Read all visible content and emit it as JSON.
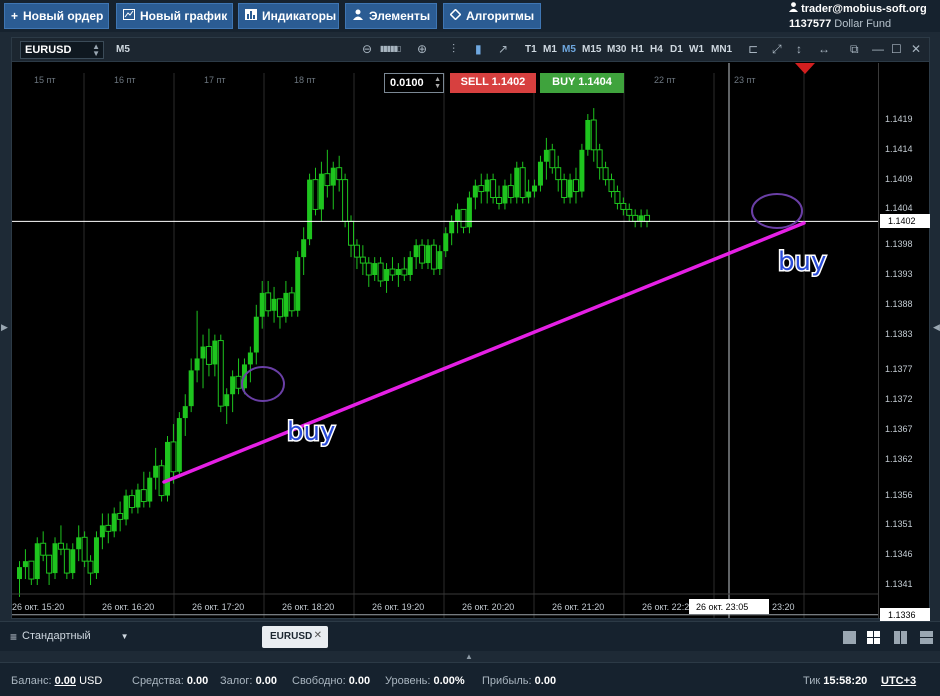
{
  "toolbar": {
    "new_order": "Новый ордер",
    "new_chart": "Новый график",
    "indicators": "Индикаторы",
    "elements": "Элементы",
    "algorithms": "Алгоритмы"
  },
  "account": {
    "email": "trader@mobius-soft.org",
    "account_id": "1137577",
    "fund_name": "Dollar Fund"
  },
  "chart": {
    "symbol": "EURUSD",
    "timeframe": "M5",
    "timeframes": [
      "T1",
      "M1",
      "M5",
      "M15",
      "M30",
      "H1",
      "H4",
      "D1",
      "W1",
      "MN1"
    ],
    "active_timeframe": "M5",
    "lot": "0.0100",
    "sell_label": "SELL",
    "sell_price": "1.1402",
    "buy_label": "BUY",
    "buy_price": "1.1404",
    "top_day_labels": [
      "15 пт",
      "16 пт",
      "17 пт",
      "18 пт",
      "22 пт",
      "23 пт"
    ],
    "price_labels": [
      "1.1419",
      "1.1414",
      "1.1409",
      "1.1404",
      "1.1398",
      "1.1393",
      "1.1388",
      "1.1383",
      "1.1377",
      "1.1372",
      "1.1367",
      "1.1362",
      "1.1356",
      "1.1351",
      "1.1346",
      "1.1341"
    ],
    "current_price": "1.1402",
    "low_price_marker": "1.1336",
    "time_labels": [
      "26 окт. 15:20",
      "26 окт. 16:20",
      "26 окт. 17:20",
      "26 окт. 18:20",
      "26 окт. 19:20",
      "26 окт. 20:20",
      "26 окт. 21:20",
      "26 окт. 22:20",
      "23:20"
    ],
    "crosshair_time": "26 окт. 23:05",
    "annotation_1": "buy",
    "annotation_2": "buy",
    "colors": {
      "bull": "#1ec41e",
      "trend_line": "#e520e5",
      "circle": "#6a3fa6",
      "annotation": "#2a4bd8",
      "sell": "#d7403f",
      "buy": "#3fa33d"
    },
    "chart_data": {
      "type": "candlestick",
      "ylim": [
        1.1336,
        1.1422
      ],
      "candles": [
        [
          1.1342,
          1.1345,
          1.1339,
          1.1344
        ],
        [
          1.1344,
          1.1347,
          1.1342,
          1.1345
        ],
        [
          1.1345,
          1.1344,
          1.1341,
          1.1342
        ],
        [
          1.1342,
          1.1349,
          1.1341,
          1.1348
        ],
        [
          1.1348,
          1.135,
          1.1345,
          1.1346
        ],
        [
          1.1346,
          1.1346,
          1.1341,
          1.1343
        ],
        [
          1.1343,
          1.1349,
          1.1342,
          1.1348
        ],
        [
          1.1348,
          1.1351,
          1.1346,
          1.1347
        ],
        [
          1.1347,
          1.1348,
          1.1342,
          1.1343
        ],
        [
          1.1343,
          1.1348,
          1.1342,
          1.1347
        ],
        [
          1.1347,
          1.1351,
          1.1345,
          1.1349
        ],
        [
          1.1349,
          1.135,
          1.1344,
          1.1345
        ],
        [
          1.1345,
          1.1346,
          1.1341,
          1.1343
        ],
        [
          1.1343,
          1.135,
          1.1342,
          1.1349
        ],
        [
          1.1349,
          1.1353,
          1.1347,
          1.1351
        ],
        [
          1.1351,
          1.1353,
          1.1348,
          1.135
        ],
        [
          1.135,
          1.1354,
          1.1349,
          1.1353
        ],
        [
          1.1353,
          1.1355,
          1.135,
          1.1352
        ],
        [
          1.1352,
          1.1357,
          1.1351,
          1.1356
        ],
        [
          1.1356,
          1.1357,
          1.1353,
          1.1354
        ],
        [
          1.1354,
          1.1358,
          1.1353,
          1.1357
        ],
        [
          1.1357,
          1.136,
          1.1354,
          1.1355
        ],
        [
          1.1355,
          1.136,
          1.1354,
          1.1359
        ],
        [
          1.1359,
          1.1364,
          1.1357,
          1.1361
        ],
        [
          1.1361,
          1.1362,
          1.1355,
          1.1356
        ],
        [
          1.1356,
          1.1366,
          1.1355,
          1.1365
        ],
        [
          1.1365,
          1.1368,
          1.1358,
          1.136
        ],
        [
          1.136,
          1.137,
          1.1359,
          1.1369
        ],
        [
          1.1369,
          1.1373,
          1.1366,
          1.1371
        ],
        [
          1.1371,
          1.1379,
          1.137,
          1.1377
        ],
        [
          1.1377,
          1.1387,
          1.1375,
          1.1379
        ],
        [
          1.1379,
          1.1383,
          1.1374,
          1.1381
        ],
        [
          1.1381,
          1.1384,
          1.1376,
          1.1378
        ],
        [
          1.1378,
          1.1383,
          1.1376,
          1.1382
        ],
        [
          1.1382,
          1.1383,
          1.137,
          1.1371
        ],
        [
          1.1371,
          1.1374,
          1.1368,
          1.1373
        ],
        [
          1.1373,
          1.1377,
          1.137,
          1.1376
        ],
        [
          1.1376,
          1.1379,
          1.1373,
          1.1374
        ],
        [
          1.1374,
          1.1379,
          1.1373,
          1.1378
        ],
        [
          1.1378,
          1.1381,
          1.1375,
          1.138
        ],
        [
          1.138,
          1.1388,
          1.1378,
          1.1386
        ],
        [
          1.1386,
          1.1392,
          1.1384,
          1.139
        ],
        [
          1.139,
          1.1392,
          1.1386,
          1.1387
        ],
        [
          1.1387,
          1.1391,
          1.1385,
          1.1389
        ],
        [
          1.1389,
          1.1389,
          1.1384,
          1.1386
        ],
        [
          1.1386,
          1.1392,
          1.1385,
          1.139
        ],
        [
          1.139,
          1.1391,
          1.1386,
          1.1387
        ],
        [
          1.1387,
          1.1397,
          1.1386,
          1.1396
        ],
        [
          1.1396,
          1.1401,
          1.1393,
          1.1399
        ],
        [
          1.1399,
          1.141,
          1.1398,
          1.1409
        ],
        [
          1.1409,
          1.1411,
          1.1403,
          1.1404
        ],
        [
          1.1404,
          1.1412,
          1.1402,
          1.141
        ],
        [
          1.141,
          1.1414,
          1.1406,
          1.1408
        ],
        [
          1.1408,
          1.1412,
          1.1404,
          1.1411
        ],
        [
          1.1411,
          1.1413,
          1.1407,
          1.1409
        ],
        [
          1.1409,
          1.141,
          1.1401,
          1.1402
        ],
        [
          1.1402,
          1.1403,
          1.1396,
          1.1398
        ],
        [
          1.1398,
          1.1399,
          1.1394,
          1.1396
        ],
        [
          1.1396,
          1.1398,
          1.1393,
          1.1395
        ],
        [
          1.1395,
          1.1396,
          1.1391,
          1.1393
        ],
        [
          1.1393,
          1.1396,
          1.1392,
          1.1395
        ],
        [
          1.1395,
          1.1396,
          1.1391,
          1.1392
        ],
        [
          1.1392,
          1.1395,
          1.139,
          1.1394
        ],
        [
          1.1394,
          1.1396,
          1.1392,
          1.1393
        ],
        [
          1.1393,
          1.1395,
          1.1391,
          1.1394
        ],
        [
          1.1394,
          1.1396,
          1.1392,
          1.1393
        ],
        [
          1.1393,
          1.1397,
          1.1392,
          1.1396
        ],
        [
          1.1396,
          1.1399,
          1.1394,
          1.1398
        ],
        [
          1.1398,
          1.1399,
          1.1394,
          1.1395
        ],
        [
          1.1395,
          1.1399,
          1.1394,
          1.1398
        ],
        [
          1.1398,
          1.1399,
          1.1393,
          1.1394
        ],
        [
          1.1394,
          1.1398,
          1.1393,
          1.1397
        ],
        [
          1.1397,
          1.1401,
          1.1396,
          1.14
        ],
        [
          1.14,
          1.1403,
          1.1398,
          1.1402
        ],
        [
          1.1402,
          1.1405,
          1.14,
          1.1404
        ],
        [
          1.1404,
          1.1404,
          1.14,
          1.1401
        ],
        [
          1.1401,
          1.1407,
          1.14,
          1.1406
        ],
        [
          1.1406,
          1.1409,
          1.1404,
          1.1408
        ],
        [
          1.1408,
          1.141,
          1.1405,
          1.1407
        ],
        [
          1.1407,
          1.141,
          1.1405,
          1.1409
        ],
        [
          1.1409,
          1.141,
          1.1405,
          1.1406
        ],
        [
          1.1406,
          1.1408,
          1.1404,
          1.1405
        ],
        [
          1.1405,
          1.1409,
          1.1404,
          1.1408
        ],
        [
          1.1408,
          1.141,
          1.1405,
          1.1406
        ],
        [
          1.1406,
          1.1412,
          1.1405,
          1.1411
        ],
        [
          1.1411,
          1.1412,
          1.1405,
          1.1406
        ],
        [
          1.1406,
          1.1409,
          1.1405,
          1.1407
        ],
        [
          1.1407,
          1.1409,
          1.1406,
          1.1408
        ],
        [
          1.1408,
          1.1413,
          1.1407,
          1.1412
        ],
        [
          1.1412,
          1.1416,
          1.1409,
          1.1414
        ],
        [
          1.1414,
          1.1415,
          1.141,
          1.1411
        ],
        [
          1.1411,
          1.1413,
          1.1407,
          1.1409
        ],
        [
          1.1409,
          1.141,
          1.1405,
          1.1406
        ],
        [
          1.1406,
          1.141,
          1.1405,
          1.1409
        ],
        [
          1.1409,
          1.1411,
          1.1405,
          1.1407
        ],
        [
          1.1407,
          1.1415,
          1.1406,
          1.1414
        ],
        [
          1.1414,
          1.142,
          1.1413,
          1.1419
        ],
        [
          1.1419,
          1.1421,
          1.1412,
          1.1414
        ],
        [
          1.1414,
          1.1415,
          1.1409,
          1.1411
        ],
        [
          1.1411,
          1.1412,
          1.1408,
          1.1409
        ],
        [
          1.1409,
          1.141,
          1.1406,
          1.1407
        ],
        [
          1.1407,
          1.1408,
          1.1404,
          1.1405
        ],
        [
          1.1405,
          1.1406,
          1.1403,
          1.1404
        ],
        [
          1.1404,
          1.1405,
          1.1402,
          1.1403
        ],
        [
          1.1403,
          1.1404,
          1.1401,
          1.1402
        ],
        [
          1.1402,
          1.1404,
          1.1401,
          1.1403
        ],
        [
          1.1403,
          1.1404,
          1.1401,
          1.1402
        ]
      ]
    }
  },
  "bottom": {
    "template": "Стандартный",
    "tab": "EURUSD"
  },
  "status": {
    "balance_label": "Баланс:",
    "balance_value": "0.00",
    "balance_ccy": "USD",
    "funds_label": "Средства:",
    "funds_value": "0.00",
    "margin_label": "Залог:",
    "margin_value": "0.00",
    "free_label": "Свободно:",
    "free_value": "0.00",
    "level_label": "Уровень:",
    "level_value": "0.00%",
    "profit_label": "Прибыль:",
    "profit_value": "0.00",
    "tick_label": "Тик",
    "tick_time": "15:58:20",
    "timezone": "UTC+3"
  }
}
